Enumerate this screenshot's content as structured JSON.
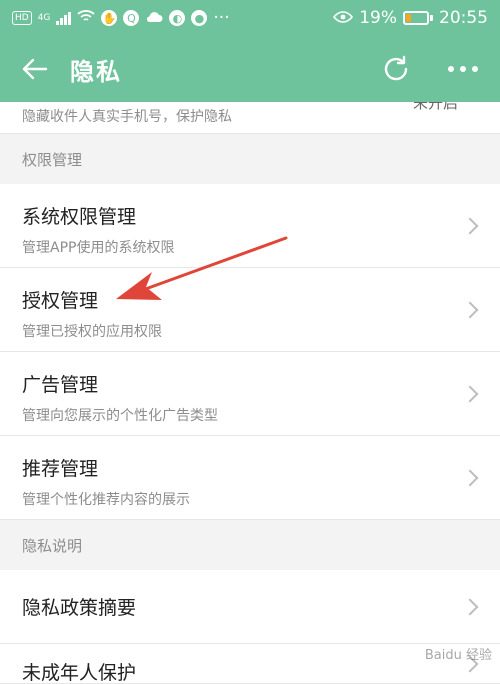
{
  "status_bar": {
    "hd": "HD",
    "network": "4G",
    "battery": "19%",
    "time": "20:55"
  },
  "header": {
    "title": "隐私"
  },
  "partial_item": {
    "subtitle": "隐藏收件人真实手机号，保护隐私",
    "right_text": "未开启"
  },
  "sections": [
    {
      "title": "权限管理",
      "items": [
        {
          "title": "系统权限管理",
          "subtitle": "管理APP使用的系统权限"
        },
        {
          "title": "授权管理",
          "subtitle": "管理已授权的应用权限"
        },
        {
          "title": "广告管理",
          "subtitle": "管理向您展示的个性化广告类型"
        },
        {
          "title": "推荐管理",
          "subtitle": "管理个性化推荐内容的展示"
        }
      ]
    },
    {
      "title": "隐私说明",
      "items": [
        {
          "title": "隐私政策摘要"
        },
        {
          "title": "未成年人保护"
        }
      ]
    }
  ],
  "watermark": "Baidu 经验",
  "colors": {
    "header": "#6fc39c",
    "annotation_arrow": "#e0453a"
  }
}
